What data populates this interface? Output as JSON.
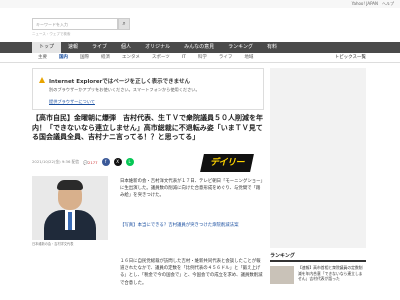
{
  "topbar": {
    "links": "Yahoo! JAPAN　ヘルプ"
  },
  "search": {
    "placeholder": "キーワードを入力",
    "hint": "ニュース・ウェブで検索"
  },
  "nav": {
    "items": [
      "トップ",
      "速報",
      "ライブ",
      "個人",
      "オリジナル",
      "みんなの意見",
      "ランキング",
      "有料"
    ]
  },
  "subnav": {
    "items": [
      "主要",
      "国内",
      "国際",
      "経済",
      "エンタメ",
      "スポーツ",
      "IT",
      "科学",
      "ライフ",
      "地域"
    ],
    "right": "トピックス一覧"
  },
  "warning": {
    "title": "Internet Explorerではページを正しく表示できません",
    "body": "別のブラウザーかアプリをお使いください。スマートフォンから使用ください。",
    "link": "提供ブラウザーについて"
  },
  "article": {
    "headline": "【高市自民】金曜朝に爆弾　吉村代表、生ＴＶで衆院議員５０人削減を年内！「できないなら連立しません」高市総裁に不退転み姿「いまＴＶ見てる国会議員全員、吉村ナニ言ってる！？と思ってる」",
    "meta": "2021/10/22(金) 9:36 配信",
    "comments": "2177",
    "logo": "デイリー",
    "caption": "日本維新の会・吉村洋文代表",
    "body1": "日本維新の会・吉村洋文代表が１７日、テレビ朝日「モーニングショー」に生出演した。議員数の削減に向けた合意形成をめぐり、与党間で「踏み絵」を突きつけた。",
    "sublink": "【写真】本当にできる？吉村議員が突きつけた衆院削減法案",
    "body2": "１６日に自民党総裁が訪問した吉村・維新共同代表と会談したことが報道されたなかで、議員の定数を「比例代表の４５６ドル」と「鍛え上げる」とし、「税金で今の国会で」と、今国会での成立を求め、議員数削減で合意した。"
  },
  "sidebar": {
    "ranking_title": "ランキング",
    "rank_text": "【速報】高市首相と衆院議員の定数削減を年内合意「できないなら連立しません」吉村代表が語った"
  }
}
